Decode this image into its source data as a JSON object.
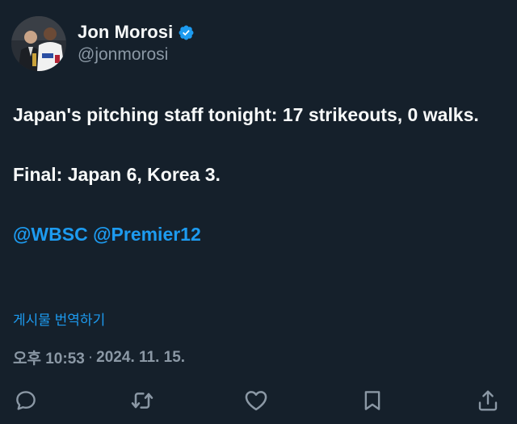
{
  "post": {
    "author": {
      "display_name": "Jon Morosi",
      "handle": "@jonmorosi",
      "verified": true,
      "avatar_icon": "profile-photo-icon"
    },
    "text": {
      "line1": "Japan's pitching staff tonight: 17 strikeouts, 0 walks.",
      "line2": "Final: Japan 6, Korea 3.",
      "mentions": [
        "@WBSC",
        "@Premier12"
      ]
    },
    "translate_label": "게시물 번역하기",
    "timestamp": {
      "time": "오후 10:53",
      "separator": "·",
      "date": "2024. 11. 15."
    }
  },
  "actions": {
    "reply_icon": "reply-icon",
    "repost_icon": "repost-icon",
    "like_icon": "like-icon",
    "bookmark_icon": "bookmark-icon",
    "share_icon": "share-icon"
  },
  "colors": {
    "background": "#15202b",
    "text": "#f7f9f9",
    "secondary": "#8b98a5",
    "accent": "#1d9bf0"
  }
}
